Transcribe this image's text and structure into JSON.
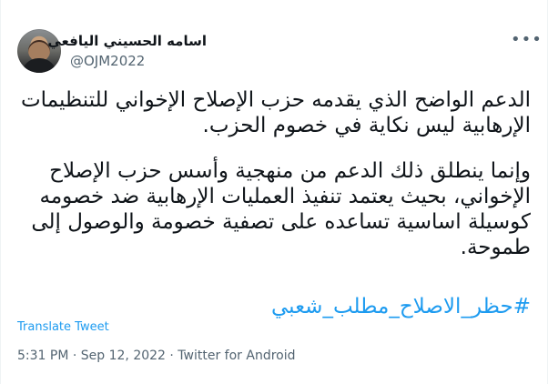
{
  "header": {
    "top_fragment": "·····",
    "display_name": "اسامه الحسيني اليافعي",
    "handle": "@OJM2022",
    "more_icon": "more-horizontal-icon"
  },
  "tweet": {
    "lines": [
      "الدعم الواضح الذي يقدمه حزب الإصلاح الإخواني للتنظيمات",
      "الإرهابية ليس نكاية في خصوم الحزب.",
      "وإنما ينطلق ذلك الدعم من منهجية وأسس حزب الإصلاح",
      "الإخواني، بحيث يعتمد تنفيذ العمليات الإرهابية ضد خصومه",
      "كوسيلة اساسية تساعده على تصفية خصومة والوصول إلى",
      "طموحة."
    ],
    "hashtag": "#حظر_الاصلاح_مطلب_شعبي",
    "translate_label": "Translate Tweet",
    "metadata": "5:31 PM · Sep 12, 2022 · Twitter for Android"
  },
  "colors": {
    "text": "#0f1419",
    "secondary": "#536471",
    "link": "#1d9bf0",
    "background": "#ffffff"
  }
}
